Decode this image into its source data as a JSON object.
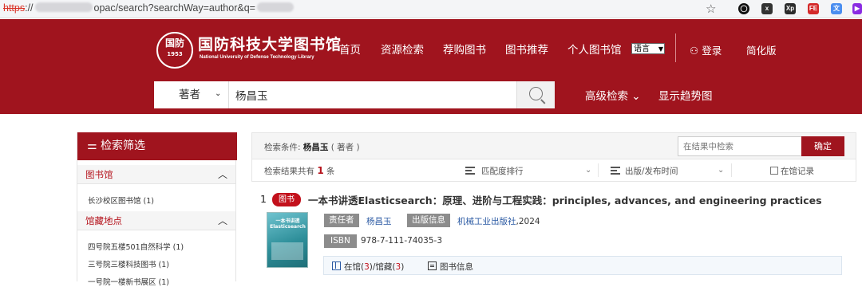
{
  "browser": {
    "url_protocol": "https",
    "url_sep": "://",
    "url_mid": "opac/search?searchWay=author&q="
  },
  "header": {
    "seal_top": "国防",
    "seal_bottom": "1953",
    "logo_cn": "国防科技大学图书馆",
    "logo_en": "National University of Defense Technology Library",
    "nav": [
      "首页",
      "资源检索",
      "荐购图书",
      "图书推荐",
      "个人图书馆"
    ],
    "lang_select": "语言",
    "login": "登录",
    "traditional": "简化版"
  },
  "search": {
    "type": "著者",
    "query": "杨昌玉",
    "advanced": "高级检索",
    "trend": "显示趋势图"
  },
  "sidebar": {
    "title": "检索筛选",
    "sections": [
      {
        "title": "图书馆",
        "items": [
          "长沙校区图书馆 (1)"
        ]
      },
      {
        "title": "馆藏地点",
        "items": [
          "四号院五楼501自然科学 (1)",
          "三号院三楼科技图书 (1)",
          "一号院一楼新书展区 (1)"
        ]
      }
    ]
  },
  "results_header": {
    "condition_label": "检索条件:",
    "condition_value": "杨昌玉",
    "condition_type": "( 著者 )",
    "filter_placeholder": "在结果中检索",
    "confirm": "确定",
    "count_pre": "检索结果共有",
    "count": "1",
    "count_post": "条",
    "sort_relevance": "匹配度排行",
    "sort_date": "出版/发布时间",
    "holdings_check": "在馆记录"
  },
  "results": [
    {
      "index": "1",
      "type": "图书",
      "title": "一本书讲透Elasticsearch：原理、进阶与工程实践：principles, advances, and engineering practices",
      "cover_title": "一本书讲透 Elasticsearch",
      "author_label": "责任者",
      "author": "杨昌玉",
      "publisher_label": "出版信息",
      "publisher": "机械工业出版社",
      "year": ",2024",
      "isbn_label": "ISBN",
      "isbn": "978-7-111-74035-3",
      "holdings_prefix": "在馆(",
      "available": "3",
      "holdings_mid": ")/馆藏(",
      "total": "3",
      "holdings_suffix": ")",
      "info_label": "图书信息"
    }
  ],
  "colors": {
    "brand": "#a0141e",
    "badge": "#c3111c",
    "link": "#2b5aa3"
  }
}
